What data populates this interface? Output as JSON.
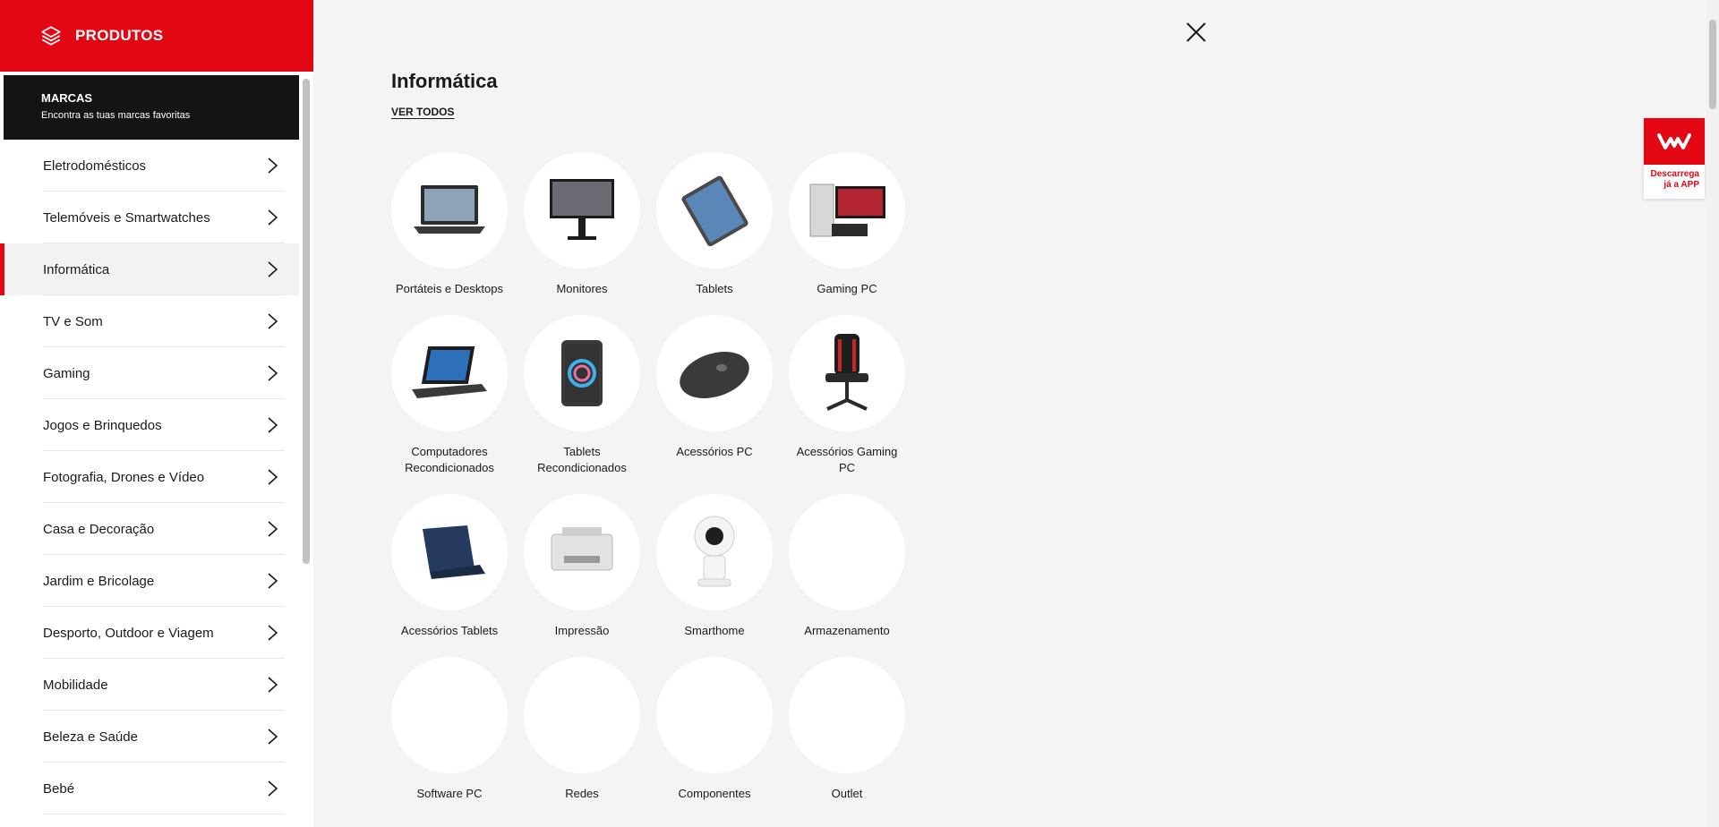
{
  "sidebar": {
    "title": "PRODUTOS",
    "brands": {
      "title": "MARCAS",
      "subtitle": "Encontra as tuas marcas favoritas"
    },
    "items": [
      {
        "label": "Eletrodomésticos"
      },
      {
        "label": "Telemóveis e Smartwatches"
      },
      {
        "label": "Informática"
      },
      {
        "label": "TV e Som"
      },
      {
        "label": "Gaming"
      },
      {
        "label": "Jogos e Brinquedos"
      },
      {
        "label": "Fotografia, Drones e Vídeo"
      },
      {
        "label": "Casa e Decoração"
      },
      {
        "label": "Jardim e Bricolage"
      },
      {
        "label": "Desporto, Outdoor e Viagem"
      },
      {
        "label": "Mobilidade"
      },
      {
        "label": "Beleza e Saúde"
      },
      {
        "label": "Bebé"
      }
    ],
    "active_item": "Informática"
  },
  "main": {
    "category_title": "Informática",
    "see_all": "VER TODOS",
    "tiles": [
      {
        "label": "Portáteis e Desktops",
        "icon": "laptop-icon"
      },
      {
        "label": "Monitores",
        "icon": "monitor-icon"
      },
      {
        "label": "Tablets",
        "icon": "tablet-icon"
      },
      {
        "label": "Gaming PC",
        "icon": "gaming-pc-icon"
      },
      {
        "label": "Computadores Recondicionados",
        "icon": "refurbished-laptop-icon"
      },
      {
        "label": "Tablets Recondicionados",
        "icon": "refurbished-tablet-icon"
      },
      {
        "label": "Acessórios PC",
        "icon": "mouse-icon"
      },
      {
        "label": "Acessórios Gaming PC",
        "icon": "gaming-chair-icon"
      },
      {
        "label": "Acessórios Tablets",
        "icon": "tablet-case-icon"
      },
      {
        "label": "Impressão",
        "icon": "printer-icon"
      },
      {
        "label": "Smarthome",
        "icon": "camera-icon"
      },
      {
        "label": "Armazenamento",
        "icon": ""
      },
      {
        "label": "Software PC",
        "icon": ""
      },
      {
        "label": "Redes",
        "icon": ""
      },
      {
        "label": "Componentes",
        "icon": ""
      },
      {
        "label": "Outlet",
        "icon": ""
      }
    ]
  },
  "app_promo": {
    "line1": "Descarrega",
    "line2": "já a APP"
  },
  "colors": {
    "brand": "#e30613",
    "dark": "#141414",
    "background": "#f4f4f4"
  }
}
